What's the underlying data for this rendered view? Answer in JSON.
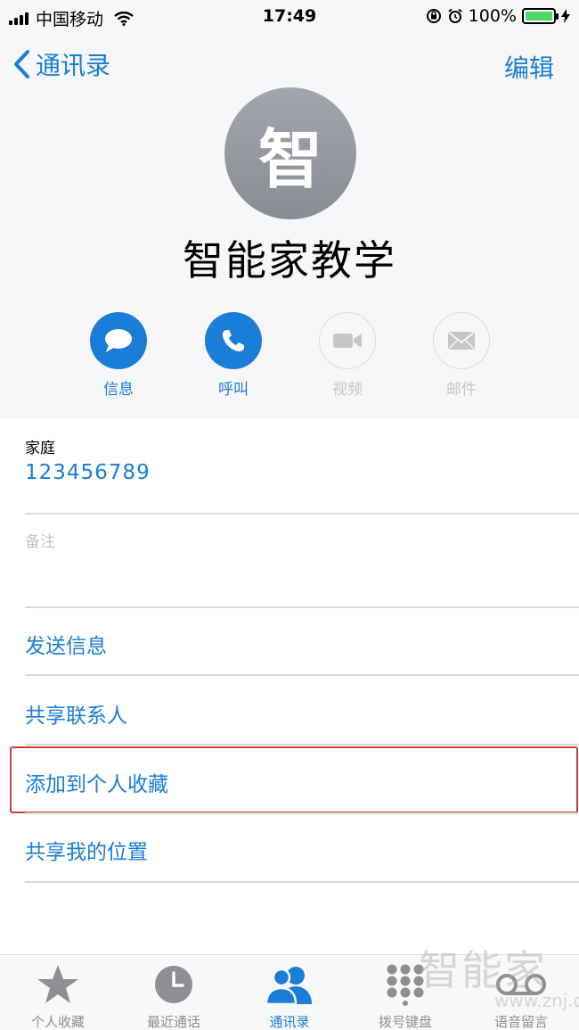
{
  "status_bar": {
    "carrier": "中国移动",
    "time": "17:49",
    "battery": "100%",
    "battery_level": 1.0
  },
  "nav": {
    "back_label": "通讯录",
    "edit_label": "编辑"
  },
  "contact": {
    "avatar_initial": "智",
    "name": "智能家教学"
  },
  "actions": [
    {
      "label": "信息",
      "icon": "message-icon",
      "enabled": true
    },
    {
      "label": "呼叫",
      "icon": "phone-icon",
      "enabled": true
    },
    {
      "label": "视频",
      "icon": "video-icon",
      "enabled": false
    },
    {
      "label": "邮件",
      "icon": "mail-icon",
      "enabled": false
    }
  ],
  "details": {
    "phone_label": "家庭",
    "phone_value": "123456789",
    "notes_label": "备注"
  },
  "options": [
    {
      "label": "发送信息"
    },
    {
      "label": "共享联系人"
    },
    {
      "label": "添加到个人收藏",
      "highlighted": true
    },
    {
      "label": "共享我的位置"
    }
  ],
  "tabs": [
    {
      "label": "个人收藏",
      "icon": "star-icon",
      "active": false
    },
    {
      "label": "最近通话",
      "icon": "clock-icon",
      "active": false
    },
    {
      "label": "通讯录",
      "icon": "contacts-icon",
      "active": true
    },
    {
      "label": "拨号键盘",
      "icon": "keypad-icon",
      "active": false
    },
    {
      "label": "语音留言",
      "icon": "voicemail-icon",
      "active": false
    }
  ],
  "watermark": {
    "main": "智能家",
    "sub": "www.znj.com"
  },
  "colors": {
    "accent": "#1a7dd7",
    "inactive": "#c6c6c9",
    "highlight_border": "#d23a3a"
  }
}
